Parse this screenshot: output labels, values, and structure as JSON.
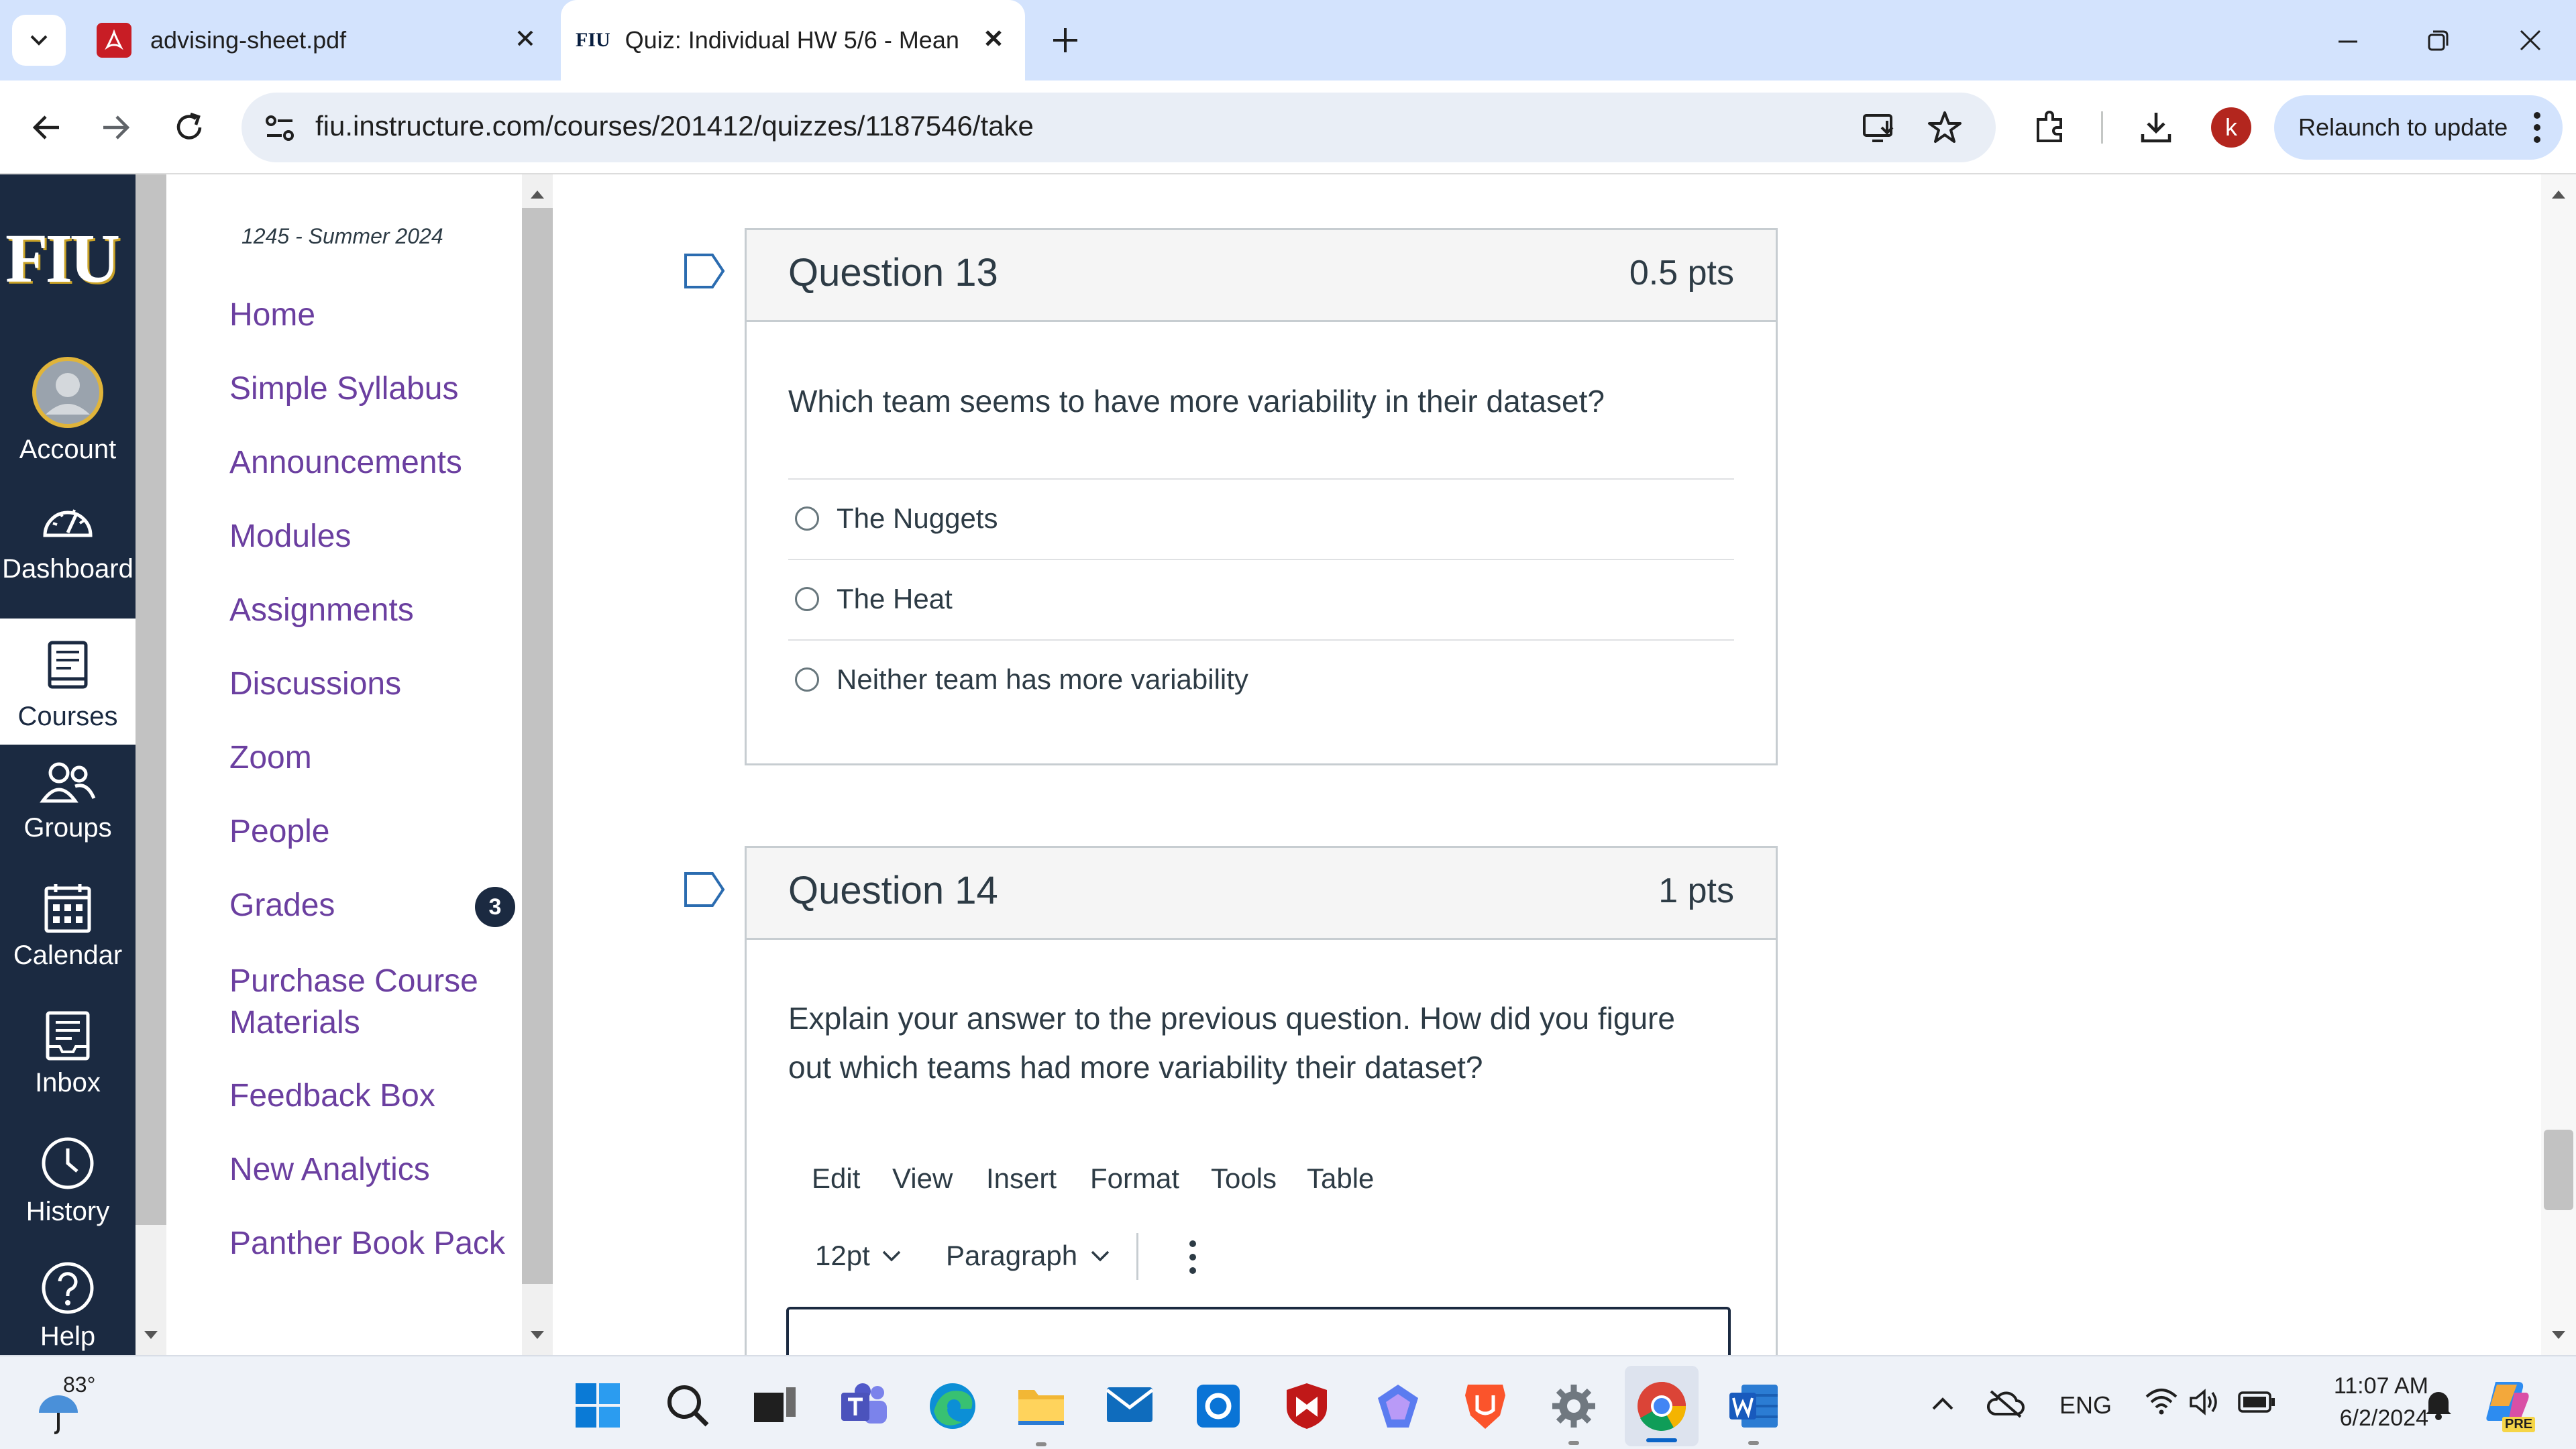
{
  "browser": {
    "tabs": [
      {
        "title": "advising-sheet.pdf",
        "favicon": "pdf-icon",
        "active": false
      },
      {
        "title": "Quiz: Individual HW 5/6 - Mean",
        "favicon": "FIU",
        "active": true
      }
    ],
    "url": "fiu.instructure.com/courses/201412/quizzes/1187546/take",
    "profile_initial": "k",
    "relaunch_label": "Relaunch to update"
  },
  "global_nav": {
    "logo": "FIU",
    "items": [
      {
        "label": "Account",
        "icon": "account-avatar-icon"
      },
      {
        "label": "Dashboard",
        "icon": "dashboard-gauge-icon"
      },
      {
        "label": "Courses",
        "icon": "courses-book-icon",
        "active": true
      },
      {
        "label": "Groups",
        "icon": "groups-people-icon"
      },
      {
        "label": "Calendar",
        "icon": "calendar-icon"
      },
      {
        "label": "Inbox",
        "icon": "inbox-icon"
      },
      {
        "label": "History",
        "icon": "history-clock-icon"
      },
      {
        "label": "Help",
        "icon": "help-question-icon"
      }
    ]
  },
  "course_nav": {
    "term": "1245 - Summer 2024",
    "items": [
      {
        "label": "Home"
      },
      {
        "label": "Simple Syllabus"
      },
      {
        "label": "Announcements"
      },
      {
        "label": "Modules"
      },
      {
        "label": "Assignments"
      },
      {
        "label": "Discussions"
      },
      {
        "label": "Zoom"
      },
      {
        "label": "People"
      },
      {
        "label": "Grades",
        "badge": "3"
      },
      {
        "label": "Purchase Course Materials"
      },
      {
        "label": "Feedback Box"
      },
      {
        "label": "New Analytics"
      },
      {
        "label": "Panther Book Pack"
      }
    ]
  },
  "questions": [
    {
      "title": "Question 13",
      "points": "0.5 pts",
      "text": "Which team seems to have more variability in their dataset?",
      "answers": [
        "The Nuggets",
        "The Heat",
        "Neither team has more variability"
      ]
    },
    {
      "title": "Question 14",
      "points": "1 pts",
      "text_line1": "Explain your answer to the previous question. How did you figure",
      "text_line2": "out which teams had more variability their dataset?",
      "editor": {
        "menu": [
          "Edit",
          "View",
          "Insert",
          "Format",
          "Tools",
          "Table"
        ],
        "font_size": "12pt",
        "block_format": "Paragraph"
      }
    }
  ],
  "taskbar": {
    "weather_temp": "83°",
    "language": "ENG",
    "time": "11:07 AM",
    "date": "6/2/2024",
    "copilot_badge": "PRE"
  },
  "colors": {
    "nav_bg": "#1b2a41",
    "link_purple": "#6b3fa0",
    "badge_bg": "#1b2a41",
    "tab_strip": "#d3e3fd",
    "profile_red": "#b3261e"
  }
}
